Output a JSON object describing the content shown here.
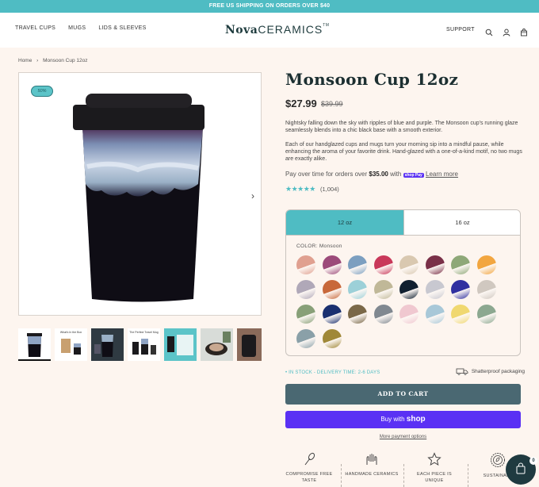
{
  "announcement": "FREE US SHIPPING ON ORDERS OVER $40",
  "nav": {
    "links": [
      "TRAVEL CUPS",
      "MUGS",
      "LIDS & SLEEVES"
    ],
    "logo_bold": "Nova",
    "logo_light": "CERAMICS",
    "logo_tm": "TM",
    "support": "SUPPORT",
    "icons": [
      "search-icon",
      "account-icon",
      "cart-icon"
    ]
  },
  "breadcrumb": {
    "home": "Home",
    "current": "Monsoon Cup 12oz"
  },
  "gallery": {
    "badge": "50%",
    "thumb_labels": [
      "",
      "What's In the Box",
      "",
      "The Perfect Travel Mug",
      "",
      "",
      ""
    ]
  },
  "product": {
    "title": "Monsoon Cup 12oz",
    "price": "$27.99",
    "compare_price": "$39.99",
    "description_1": "Nightsky falling down the sky with ripples of blue and purple. The Monsoon cup's running glaze seamlessly blends into a chic black base with a smooth exterior.",
    "description_2": "Each of our handglazed cups and mugs turn your morning sip into a mindful pause, while enhancing the aroma of your favorite drink. Hand-glazed with a one-of-a-kind motif, no two mugs are exactly alike.",
    "pay_text": "Pay over time for orders over",
    "pay_amount": "$35.00",
    "pay_with": "with",
    "shop_pay_badge": "shop Pay",
    "learn_more": "Learn more",
    "rating_stars": "★★★★★",
    "rating": 5,
    "review_count": "(1,004)"
  },
  "options": {
    "sizes": [
      "12 oz",
      "16 oz"
    ],
    "selected_size": "12 oz",
    "color_label": "COLOR: Monsoon",
    "swatches": [
      "#e0a090",
      "#9c4a7a",
      "#7c9fc0",
      "#c9385a",
      "#d9c8b0",
      "#7a3048",
      "#8ea878",
      "#f2a640",
      "#b0a8b8",
      "#c8683a",
      "#9cd0d8",
      "#c0b898",
      "#102030",
      "#c8c8d0",
      "#3030a0",
      "#d0c8c0",
      "#88a078",
      "#1a3070",
      "#7a6848",
      "#808890",
      "#f0c8d0",
      "#a8c8d8",
      "#f0d870",
      "#8ca890",
      "#8aa0a8",
      "#a08838"
    ]
  },
  "stock": "• IN STOCK - DELIVERY TIME: 2-6 DAYS",
  "shatterproof": "Shatterproof packaging",
  "buttons": {
    "add_to_cart": "ADD TO CART",
    "buy_with": "Buy with",
    "shop": "shop",
    "more_payment": "More payment options"
  },
  "features": [
    {
      "icon": "whisk-icon",
      "label": "COMPROMISE FREE TASTE"
    },
    {
      "icon": "hands-icon",
      "label": "HANDMADE CERAMICS"
    },
    {
      "icon": "star-icon",
      "label": "EACH PIECE IS UNIQUE"
    },
    {
      "icon": "leaf-badge-icon",
      "label": "SUSTAINABL"
    }
  ],
  "cart_count": "0"
}
